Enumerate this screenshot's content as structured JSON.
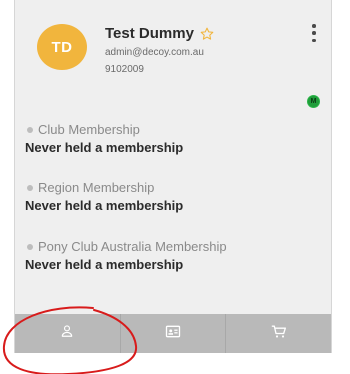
{
  "profile": {
    "initials": "TD",
    "name": "Test Dummy",
    "email": "admin@decoy.com.au",
    "number": "9102009",
    "avatar_color": "#f1b53d",
    "favorite_icon": "star-outline-icon",
    "menu_icon": "kebab-menu-icon"
  },
  "status": {
    "badge_text": "M",
    "color": "#1f9d3a"
  },
  "memberships": [
    {
      "label": "Club Membership",
      "value": "Never held a membership"
    },
    {
      "label": "Region Membership",
      "value": "Never held a membership"
    },
    {
      "label": "Pony Club Australia Membership",
      "value": "Never held a membership"
    }
  ],
  "bottom_nav": [
    {
      "icon": "person-icon"
    },
    {
      "icon": "id-card-icon"
    },
    {
      "icon": "cart-icon"
    }
  ],
  "colors": {
    "card_bg": "#efefef",
    "nav_bg": "#b9b9b9",
    "highlight": "#d81b1b"
  }
}
